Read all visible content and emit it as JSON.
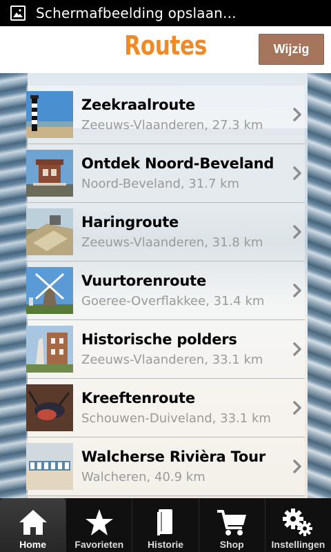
{
  "status_bar": {
    "notification": "Schermafbeelding opslaan...",
    "icon": "image-icon"
  },
  "header": {
    "title": "Routes",
    "edit_label": "Wijzig",
    "title_color": "#ef8a26",
    "button_color": "#a5755c"
  },
  "routes": [
    {
      "name": "Zeekraalroute",
      "subtitle": "Zeeuws-Vlaanderen, 27.3 km",
      "thumb": "lighthouse"
    },
    {
      "name": "Ontdek Noord-Beveland",
      "subtitle": "Noord-Beveland, 31.7 km",
      "thumb": "tower-house"
    },
    {
      "name": "Haringroute",
      "subtitle": "Zeeuws-Vlaanderen, 31.8 km",
      "thumb": "dike"
    },
    {
      "name": "Vuurtorenroute",
      "subtitle": "Goeree-Overflakkee, 31.4 km",
      "thumb": "windmill"
    },
    {
      "name": "Historische polders",
      "subtitle": "Zeeuws-Vlaanderen, 33.1 km",
      "thumb": "church"
    },
    {
      "name": "Kreeftenroute",
      "subtitle": "Schouwen-Duiveland, 33.1 km",
      "thumb": "lobster"
    },
    {
      "name": "Walcherse Rivièra Tour",
      "subtitle": "Walcheren, 40.9 km",
      "thumb": "beach-huts"
    }
  ],
  "tabs": [
    {
      "label": "Home",
      "icon": "home-icon",
      "active": true
    },
    {
      "label": "Favorieten",
      "icon": "star-icon",
      "active": false
    },
    {
      "label": "Historie",
      "icon": "book-icon",
      "active": false
    },
    {
      "label": "Shop",
      "icon": "cart-icon",
      "active": false
    },
    {
      "label": "Instellingen",
      "icon": "gears-icon",
      "active": false
    }
  ]
}
